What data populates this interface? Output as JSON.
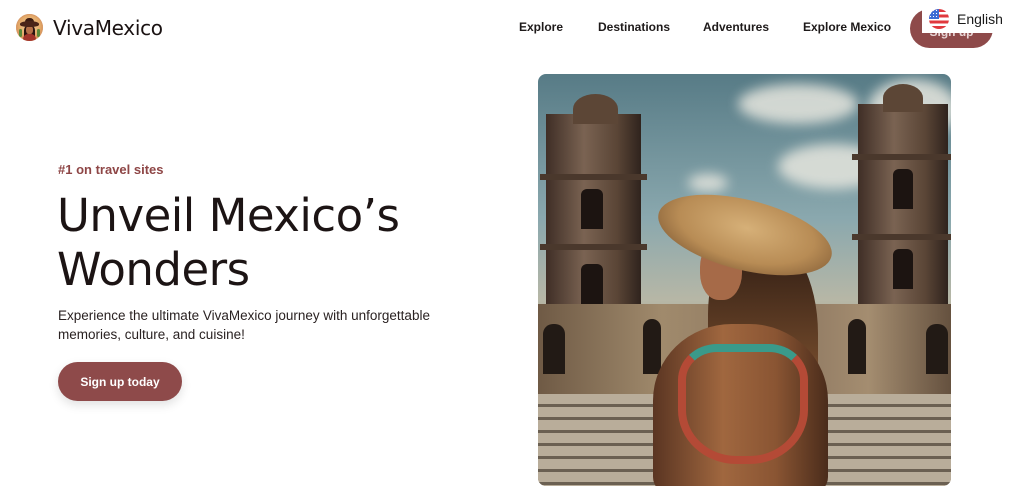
{
  "header": {
    "brand_name": "VivaMexico",
    "logo_icon": "sombrero-woman-logo",
    "nav": [
      {
        "label": "Explore"
      },
      {
        "label": "Destinations"
      },
      {
        "label": "Adventures"
      },
      {
        "label": "Explore Mexico"
      }
    ],
    "signup_label": "Sign up",
    "language": {
      "label": "English",
      "icon": "us-flag-icon"
    }
  },
  "hero": {
    "eyebrow": "#1 on travel sites",
    "headline": "Unveil Mexico’s Wonders",
    "subtext": "Experience the ultimate VivaMexico journey with unforgettable memories, culture, and cuisine!",
    "cta_label": "Sign up today",
    "image_alt": "Woman in a straw sombrero facing a baroque cathedral plaza"
  },
  "colors": {
    "accent": "#8e4a4a",
    "eyebrow": "#8e4646",
    "text": "#1c1414"
  }
}
